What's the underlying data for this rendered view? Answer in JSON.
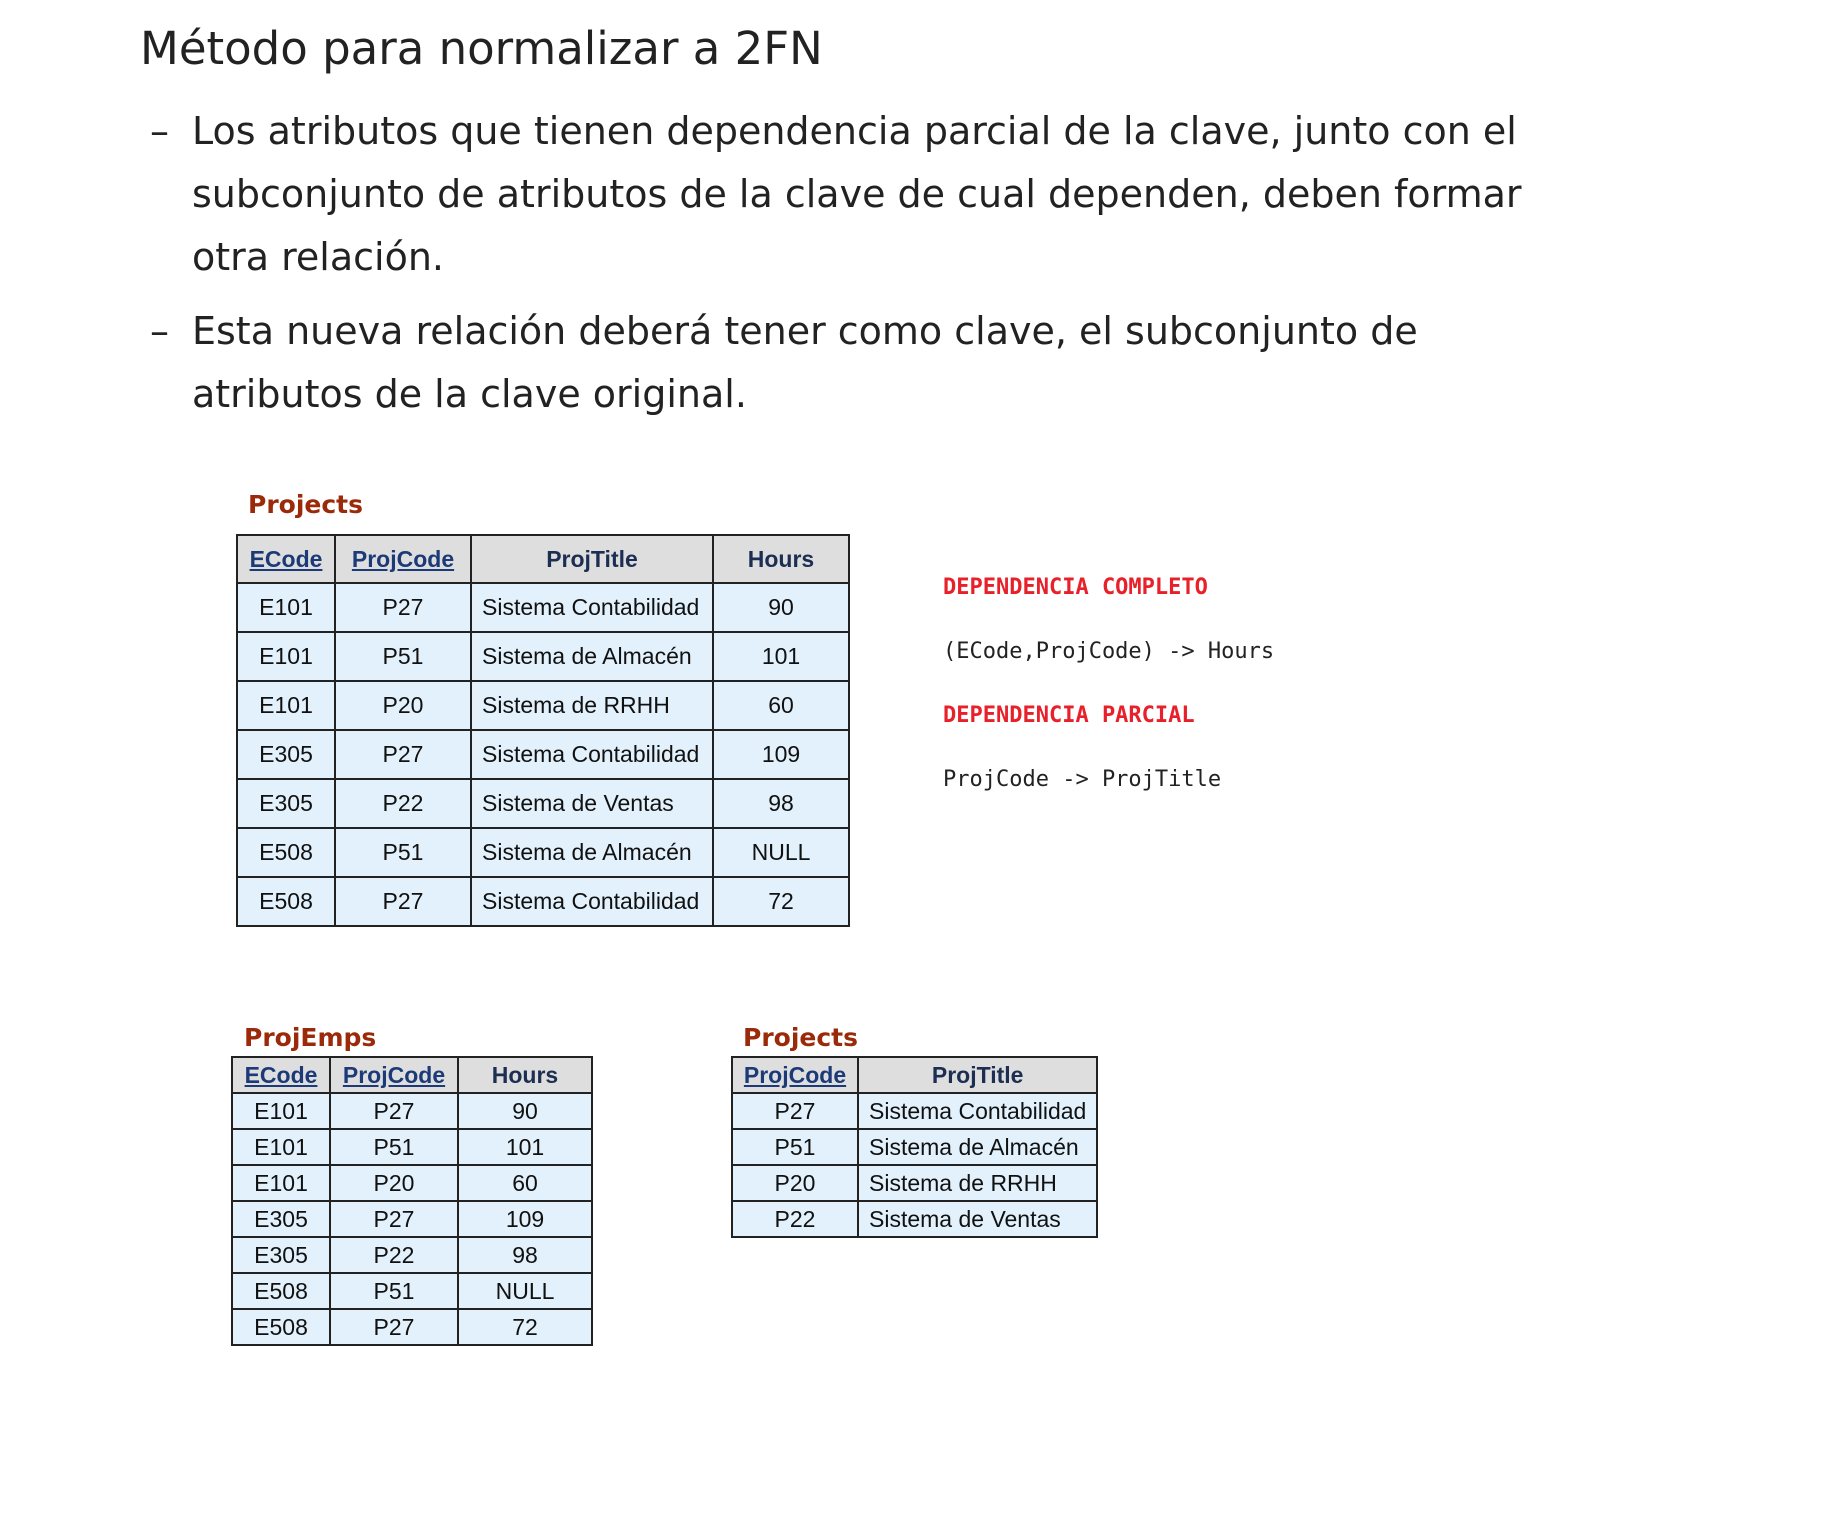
{
  "title": "Método para normalizar a 2FN",
  "bullets": [
    {
      "dash": "–",
      "text": "Los atributos que tienen dependencia parcial de la clave, junto con el subconjunto de atributos de la clave de cual dependen, deben formar otra relación."
    },
    {
      "dash": "–",
      "text": "Esta nueva relación deberá tener como clave, el subconjunto de atributos de la clave original."
    }
  ],
  "table_projects_full": {
    "caption": "Projects",
    "headers": [
      "ECode",
      "ProjCode",
      "ProjTitle",
      "Hours"
    ],
    "key_columns": [
      0,
      1
    ],
    "rows": [
      [
        "E101",
        "P27",
        "Sistema Contabilidad",
        "90"
      ],
      [
        "E101",
        "P51",
        "Sistema de Almacén",
        "101"
      ],
      [
        "E101",
        "P20",
        "Sistema de RRHH",
        "60"
      ],
      [
        "E305",
        "P27",
        "Sistema Contabilidad",
        "109"
      ],
      [
        "E305",
        "P22",
        "Sistema de Ventas",
        "98"
      ],
      [
        "E508",
        "P51",
        "Sistema de Almacén",
        "NULL"
      ],
      [
        "E508",
        "P27",
        "Sistema Contabilidad",
        "72"
      ]
    ]
  },
  "dependencies": {
    "complete_heading": "DEPENDENCIA COMPLETO",
    "complete_rule": "(ECode,ProjCode) -> Hours",
    "partial_heading": "DEPENDENCIA PARCIAL",
    "partial_rule": "ProjCode -> ProjTitle"
  },
  "table_projemps": {
    "caption": "ProjEmps",
    "headers": [
      "ECode",
      "ProjCode",
      "Hours"
    ],
    "key_columns": [
      0,
      1
    ],
    "rows": [
      [
        "E101",
        "P27",
        "90"
      ],
      [
        "E101",
        "P51",
        "101"
      ],
      [
        "E101",
        "P20",
        "60"
      ],
      [
        "E305",
        "P27",
        "109"
      ],
      [
        "E305",
        "P22",
        "98"
      ],
      [
        "E508",
        "P51",
        "NULL"
      ],
      [
        "E508",
        "P27",
        "72"
      ]
    ]
  },
  "table_projects_split": {
    "caption": "Projects",
    "headers": [
      "ProjCode",
      "ProjTitle"
    ],
    "key_columns": [
      0
    ],
    "rows": [
      [
        "P27",
        "Sistema Contabilidad"
      ],
      [
        "P51",
        "Sistema de Almacén"
      ],
      [
        "P20",
        "Sistema de RRHH"
      ],
      [
        "P22",
        "Sistema de Ventas"
      ]
    ]
  },
  "colors": {
    "caption": "#9b2a0a",
    "dependency_heading": "#e8202a",
    "header_bg": "#dedede",
    "cell_bg": "#e2f1fb"
  }
}
